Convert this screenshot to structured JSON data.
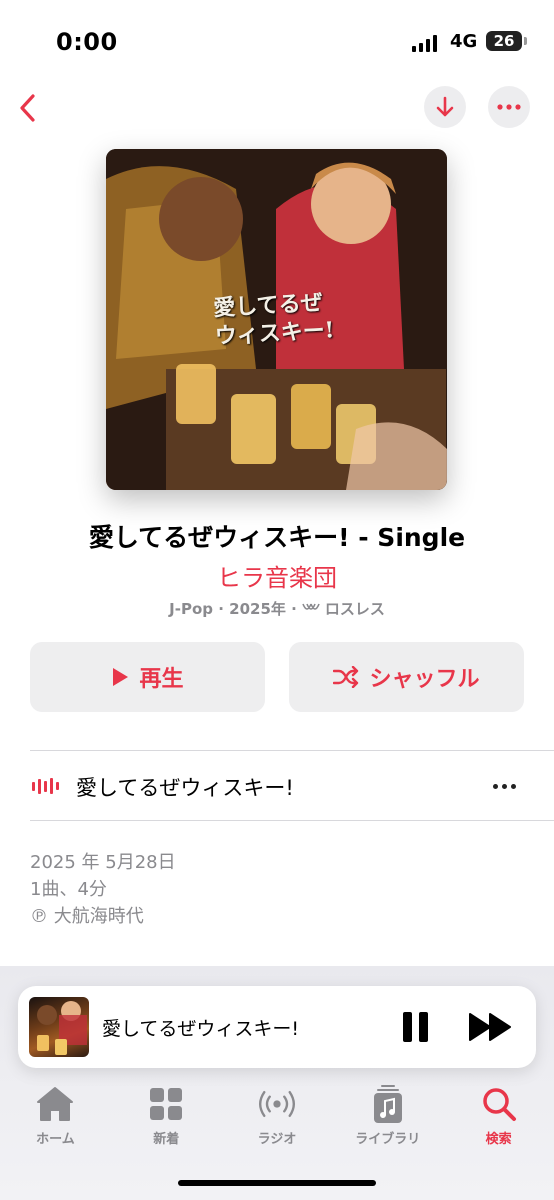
{
  "status_bar": {
    "time": "0:00",
    "network": "4G",
    "battery": "26"
  },
  "nav": {
    "back_icon": "chevron-left-icon",
    "download_icon": "arrow-down-icon",
    "more_icon": "ellipsis-icon"
  },
  "artwork": {
    "text": "愛してるぜウィスキー!"
  },
  "album": {
    "title": "愛してるぜウィスキー! - Single",
    "artist": "ヒラ音楽団",
    "meta_prefix": "J-Pop · 2025年 ·",
    "meta_lossless": "ロスレス"
  },
  "actions": {
    "play_label": "再生",
    "shuffle_label": "シャッフル"
  },
  "tracks": [
    {
      "title": "愛してるぜウィスキー!"
    }
  ],
  "info": {
    "release_date": "2025 年 5月28日",
    "summary": "1曲、4分",
    "copyright": "℗ 大航海時代"
  },
  "mini_player": {
    "title": "愛してるぜウィスキー!"
  },
  "tabs": [
    {
      "label": "ホーム",
      "icon": "home-icon"
    },
    {
      "label": "新着",
      "icon": "grid-icon"
    },
    {
      "label": "ラジオ",
      "icon": "radio-icon"
    },
    {
      "label": "ライブラリ",
      "icon": "library-icon"
    },
    {
      "label": "検索",
      "icon": "search-icon",
      "active": true
    }
  ],
  "colors": {
    "accent": "#e8364a",
    "secondary_text": "#8a8a8e",
    "button_bg": "#eeeeef"
  }
}
